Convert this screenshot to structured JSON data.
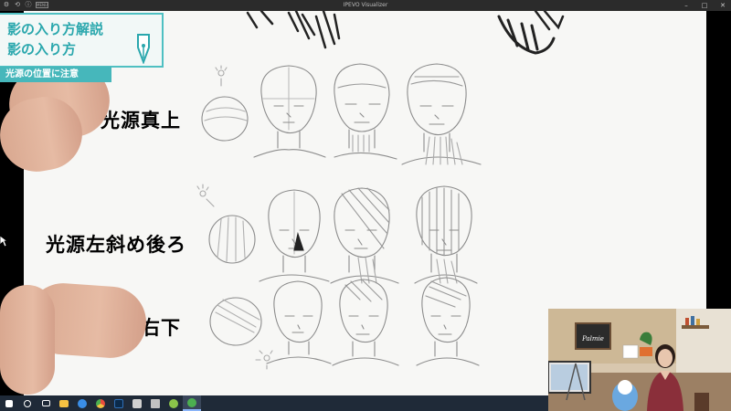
{
  "window": {
    "title": "IPEVO Visualizer",
    "toolbar_badge": "MENU",
    "controls": {
      "minimize": "–",
      "maximize": "□",
      "close": "✕"
    }
  },
  "caption": {
    "line1": "影の入り方解説",
    "line2": "影の入り方",
    "subtitle": "光源の位置に注意"
  },
  "paper": {
    "rows": [
      {
        "label": "光源真上"
      },
      {
        "label": "光源左斜め後ろ"
      },
      {
        "label": "光源右下"
      }
    ]
  },
  "webcam": {
    "sign_text": "Palmie"
  },
  "taskbar": {
    "items": [
      {
        "name": "start",
        "color": "#ffffff"
      },
      {
        "name": "search",
        "color": "#ffffff"
      },
      {
        "name": "task-view",
        "color": "#ffffff"
      },
      {
        "name": "file-explorer",
        "color": "#f5c242"
      },
      {
        "name": "edge",
        "color": "#3a8ee6"
      },
      {
        "name": "chrome",
        "color": "#e84c3d"
      },
      {
        "name": "photoshop",
        "color": "#2f6fb6"
      },
      {
        "name": "app-generic-1",
        "color": "#d0d0d0"
      },
      {
        "name": "app-generic-2",
        "color": "#c2c2c2"
      },
      {
        "name": "app-generic-3",
        "color": "#8bc34a"
      },
      {
        "name": "ipevo",
        "color": "#4caf50"
      }
    ]
  },
  "colors": {
    "accent": "#4fc0c2",
    "caption_text": "#2aa7ad",
    "caption_bar": "#46b7bb",
    "taskbar": "#1f2a38"
  }
}
